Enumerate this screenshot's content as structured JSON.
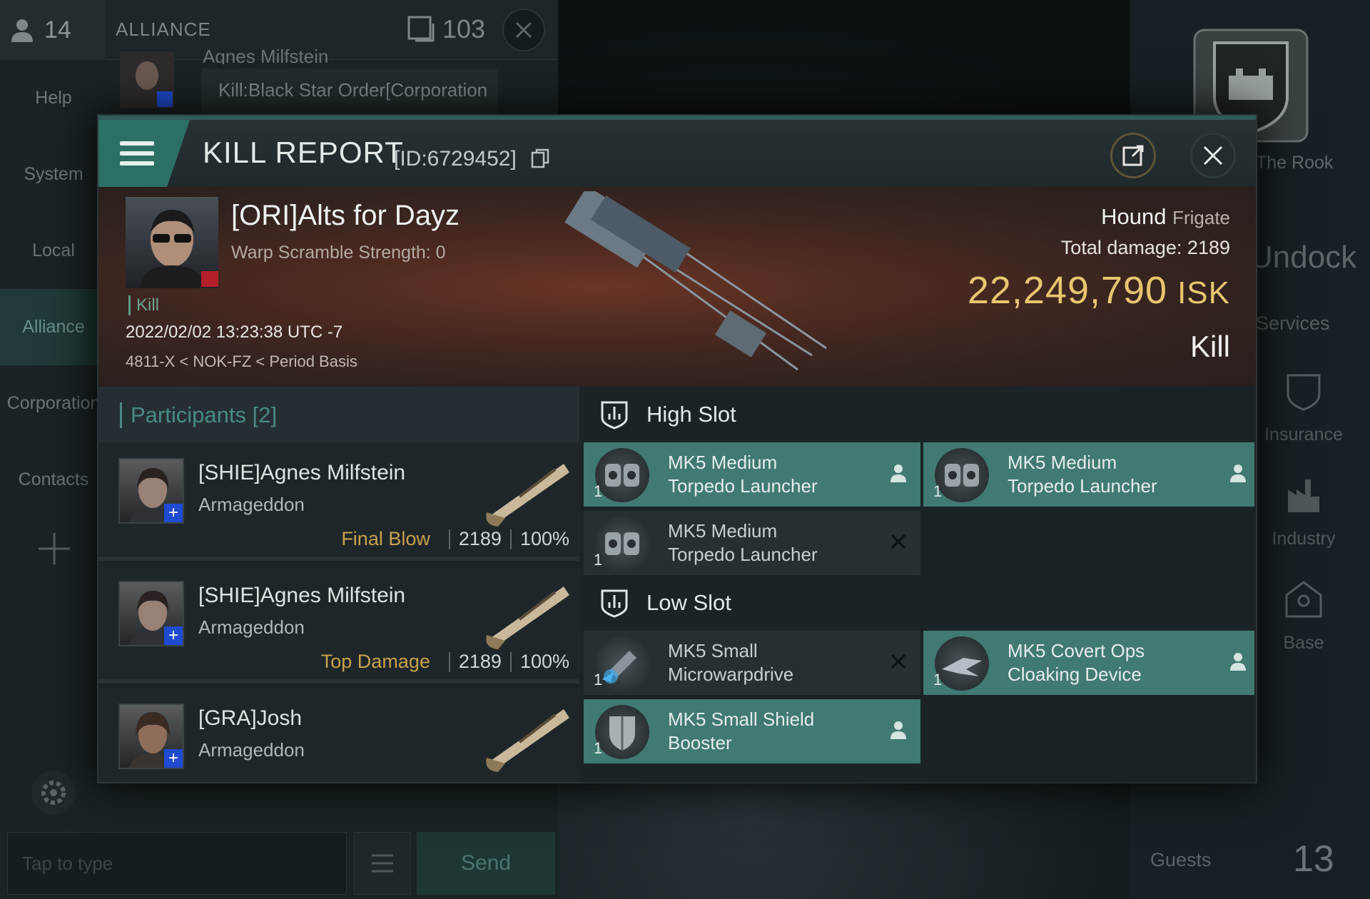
{
  "chat": {
    "member_count": "14",
    "title": "ALLIANCE",
    "online_count": "103",
    "nav": [
      "Help",
      "System",
      "Local",
      "Alliance",
      "Corporation",
      "Contacts"
    ],
    "message_name": "Agnes Milfstein",
    "message_text": "Kill:Black Star Order[Corporation",
    "input_placeholder": "Tap to type",
    "send_label": "Send"
  },
  "station": {
    "name": "The Rook",
    "undock": "Undock",
    "services_label": "Services",
    "services": [
      "Insurance",
      "Industry",
      "Base"
    ],
    "guests_label": "Guests",
    "guests_count": "13"
  },
  "report": {
    "title": "KILL REPORT",
    "id_label": "[ID:6729452]",
    "victim": {
      "name": "[ORI]Alts for Dayz",
      "warp_strength": "Warp Scramble Strength: 0",
      "tag": "Kill",
      "datetime": "2022/02/02 13:23:38 UTC -7",
      "location": "4811-X < NOK-FZ < Period Basis"
    },
    "ship": {
      "name": "Hound",
      "class": "Frigate",
      "total_damage_label": "Total damage:",
      "total_damage": "2189",
      "value": "22,249,790",
      "currency": "ISK",
      "result": "Kill"
    },
    "participants_label": "Participants",
    "participants_count": "[2]",
    "participants": [
      {
        "name": "[SHIE]Agnes Milfstein",
        "ship": "Armageddon",
        "tag": "Final Blow",
        "damage": "2189",
        "percent": "100%"
      },
      {
        "name": "[SHIE]Agnes Milfstein",
        "ship": "Armageddon",
        "tag": "Top Damage",
        "damage": "2189",
        "percent": "100%"
      },
      {
        "name": "[GRA]Josh",
        "ship": "Armageddon",
        "tag": "",
        "damage": "",
        "percent": ""
      }
    ],
    "slots": {
      "high_label": "High Slot",
      "low_label": "Low Slot",
      "high": [
        {
          "name": "MK5 Medium\nTorpedo Launcher",
          "qty": "1",
          "state": "dropped"
        },
        {
          "name": "MK5 Medium\nTorpedo Launcher",
          "qty": "1",
          "state": "dropped"
        },
        {
          "name": "MK5 Medium\nTorpedo Launcher",
          "qty": "1",
          "state": "destroyed"
        }
      ],
      "low": [
        {
          "name": "MK5 Small\nMicrowarpdrive",
          "qty": "1",
          "state": "destroyed"
        },
        {
          "name": "MK5 Covert Ops\nCloaking Device",
          "qty": "1",
          "state": "dropped"
        },
        {
          "name": "MK5 Small Shield\nBooster",
          "qty": "1",
          "state": "dropped"
        }
      ]
    }
  },
  "colors": {
    "accent": "#407a72",
    "isk": "#e7c66f",
    "final_blow": "#c9a24d",
    "close_red": "#b3202a"
  }
}
